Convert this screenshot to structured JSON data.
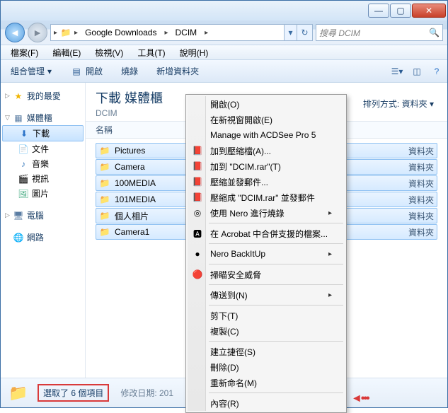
{
  "titlebar": {
    "min": "—",
    "max": "▢",
    "close": "✕"
  },
  "nav": {
    "back": "◄",
    "fwd": "►",
    "crumbs": [
      "Google Downloads",
      "DCIM"
    ],
    "sep": "▸",
    "refresh": "↻",
    "dropdown": "▾"
  },
  "search": {
    "placeholder": "搜尋 DCIM",
    "icon": "🔍"
  },
  "menubar": [
    "檔案(F)",
    "編輯(E)",
    "檢視(V)",
    "工具(T)",
    "說明(H)"
  ],
  "toolbar": {
    "organize": "組合管理",
    "open": "開啟",
    "burn": "燒錄",
    "newfolder": "新增資料夾",
    "view_down": "▾",
    "help": "?"
  },
  "sidebar": {
    "fav": "我的最愛",
    "lib": "媒體櫃",
    "lib_items": [
      {
        "icon": "dl",
        "label": "下載",
        "sel": true
      },
      {
        "icon": "doc",
        "label": "文件"
      },
      {
        "icon": "music",
        "label": "音樂"
      },
      {
        "icon": "video",
        "label": "視訊"
      },
      {
        "icon": "pic",
        "label": "圖片"
      }
    ],
    "computer": "電腦",
    "network": "網路"
  },
  "main": {
    "title": "下載 媒體櫃",
    "subtitle": "DCIM",
    "arrange_label": "排列方式:",
    "arrange_value": "資料夾",
    "col_name": "名稱",
    "files": [
      {
        "name": "Pictures",
        "type": "資料夾"
      },
      {
        "name": "Camera",
        "type": "資料夾"
      },
      {
        "name": "100MEDIA",
        "type": "資料夾"
      },
      {
        "name": "101MEDIA",
        "type": "資料夾"
      },
      {
        "name": "個人相片",
        "type": "資料夾"
      },
      {
        "name": "Camera1",
        "type": "資料夾"
      }
    ]
  },
  "status": {
    "text": "選取了 6 個項目",
    "meta": "修改日期: 201"
  },
  "context": [
    {
      "t": "item",
      "label": "開啟(O)"
    },
    {
      "t": "item",
      "label": "在新視窗開啟(E)"
    },
    {
      "t": "item",
      "label": "Manage with ACDSee Pro 5"
    },
    {
      "t": "item",
      "icon": "📕",
      "label": "加到壓縮檔(A)..."
    },
    {
      "t": "item",
      "icon": "📕",
      "label": "加到 \"DCIM.rar\"(T)"
    },
    {
      "t": "item",
      "icon": "📕",
      "label": "壓縮並發郵件..."
    },
    {
      "t": "item",
      "icon": "📕",
      "label": "壓縮成 \"DCIM.rar\" 並發郵件"
    },
    {
      "t": "item",
      "icon": "◎",
      "label": "使用 Nero 進行燒錄",
      "sub": "▸"
    },
    {
      "t": "sep"
    },
    {
      "t": "item",
      "icon": "🅰",
      "label": "在 Acrobat 中合併支援的檔案..."
    },
    {
      "t": "sep"
    },
    {
      "t": "item",
      "icon": "●",
      "label": "Nero BackItUp",
      "sub": "▸"
    },
    {
      "t": "sep"
    },
    {
      "t": "item",
      "icon": "🔴",
      "label": "掃瞄安全威脅"
    },
    {
      "t": "sep"
    },
    {
      "t": "item",
      "label": "傳送到(N)",
      "sub": "▸"
    },
    {
      "t": "sep"
    },
    {
      "t": "item",
      "label": "剪下(T)"
    },
    {
      "t": "item",
      "label": "複製(C)"
    },
    {
      "t": "sep"
    },
    {
      "t": "item",
      "label": "建立捷徑(S)"
    },
    {
      "t": "item",
      "label": "刪除(D)"
    },
    {
      "t": "item",
      "label": "重新命名(M)"
    },
    {
      "t": "sep"
    },
    {
      "t": "item",
      "label": "內容(R)"
    }
  ],
  "red_arrow": "◄•••"
}
